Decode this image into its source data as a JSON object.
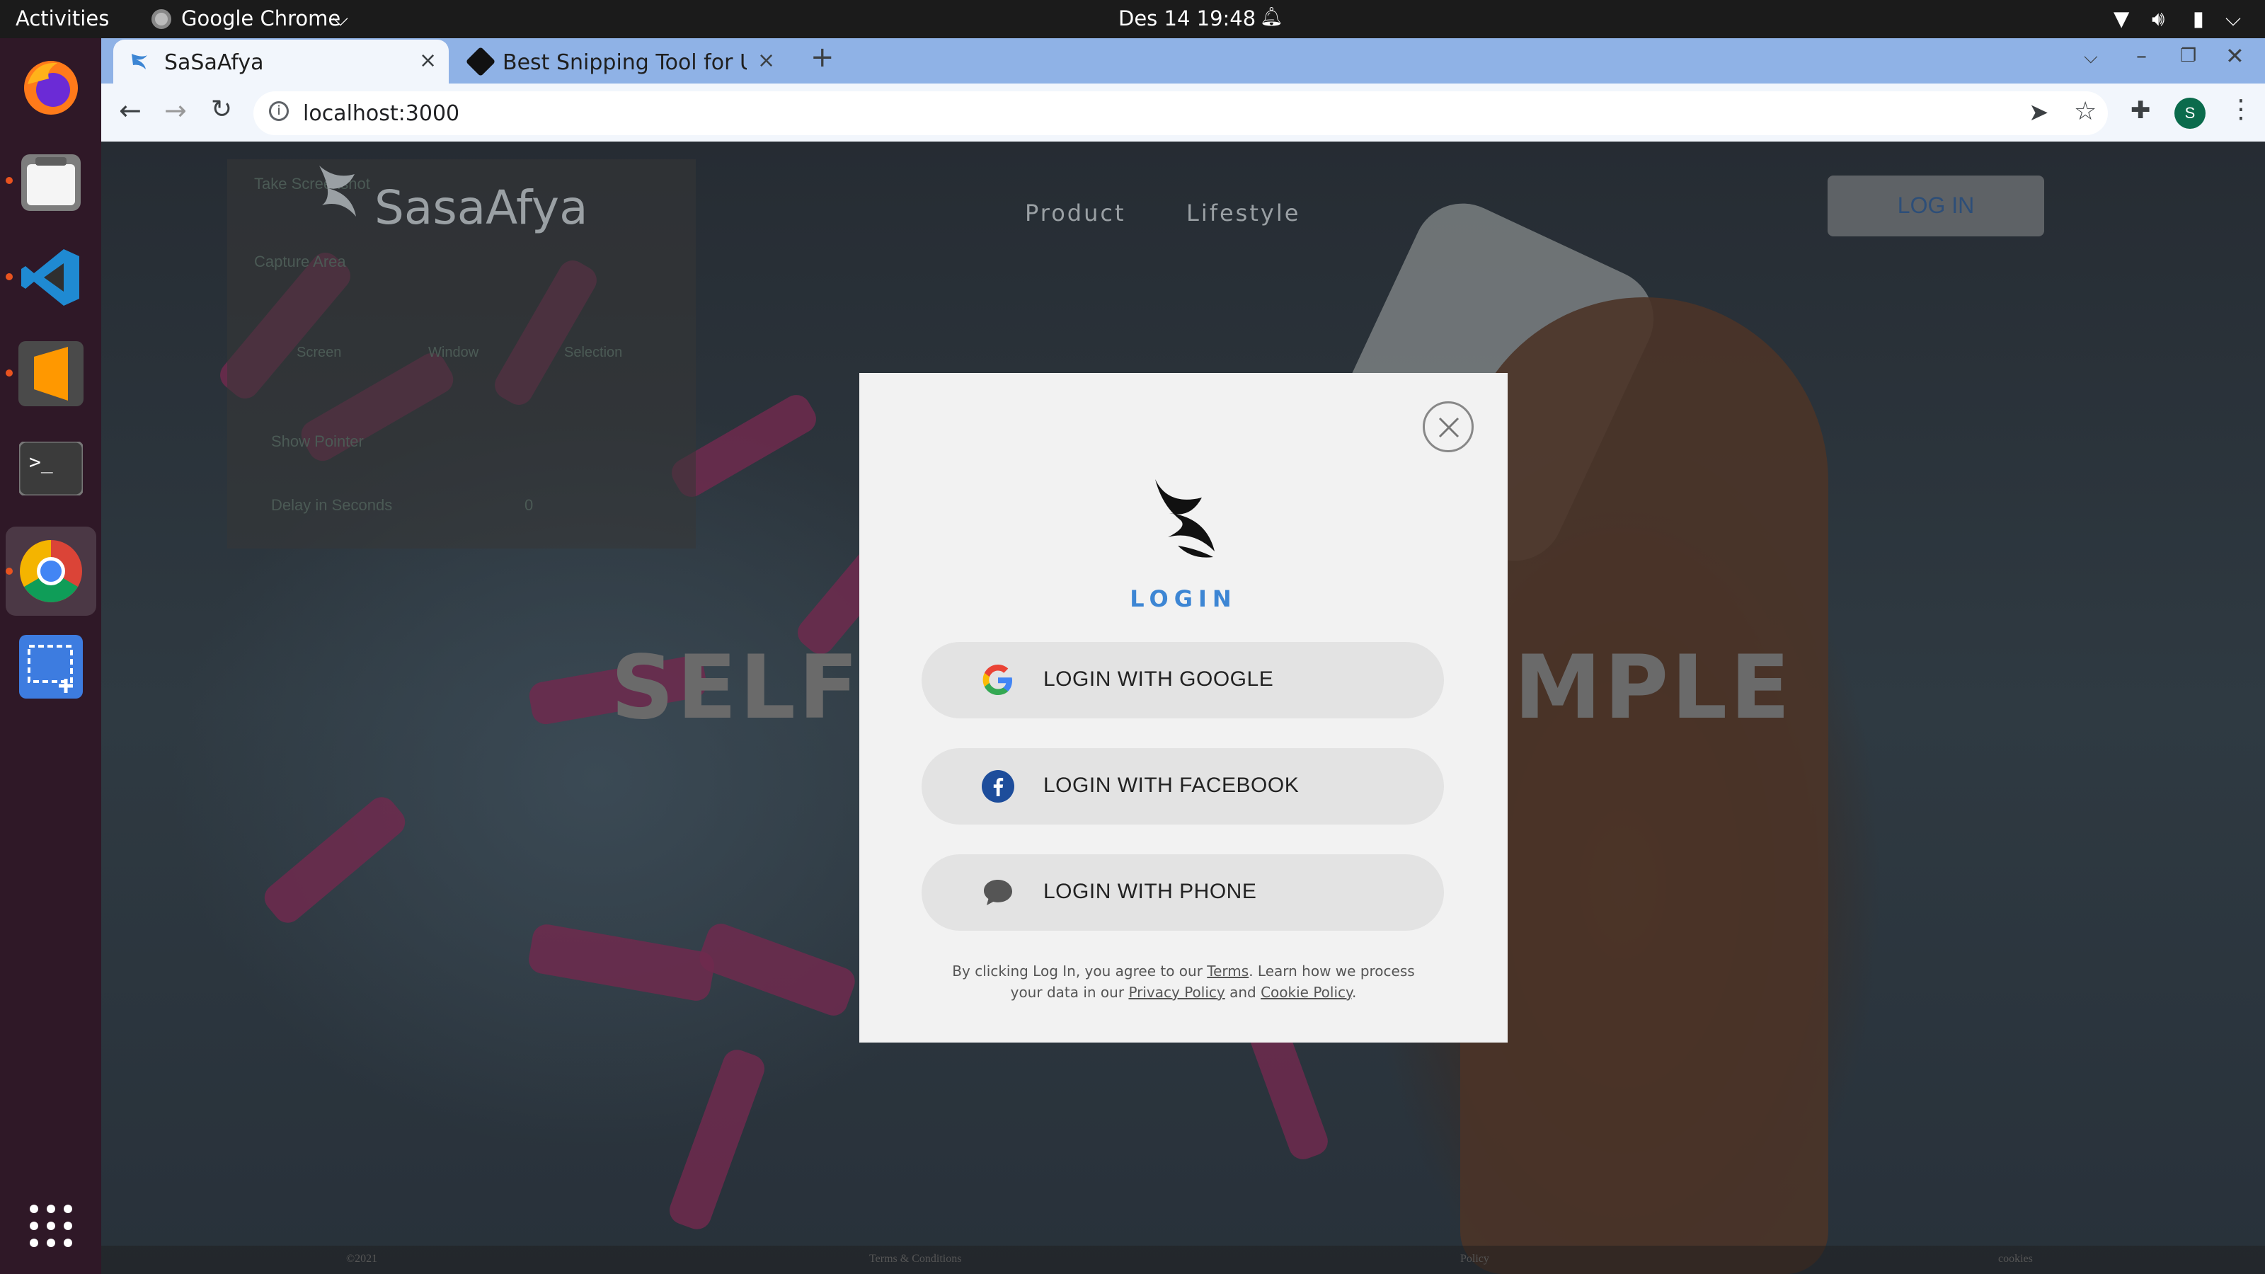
{
  "topbar": {
    "activities": "Activities",
    "app_name": "Google Chrome",
    "clock": "Des 14  19:48"
  },
  "browser": {
    "tabs": [
      {
        "title": "SaSaAfya"
      },
      {
        "title": "Best Snipping Tool for Ub"
      }
    ],
    "url": "localhost:3000",
    "profile_initial": "S"
  },
  "site": {
    "logo_text": "SasaAfya",
    "nav": [
      "Product",
      "Lifestyle"
    ],
    "login_button": "LOG IN",
    "hero_left": "SELFC",
    "hero_right": "MPLE",
    "footer": [
      "©2021",
      "Terms & Conditions",
      "Policy",
      "cookies"
    ],
    "snip_panel": {
      "title": "Take Screenshot",
      "section": "Capture Area",
      "options": [
        "Screen",
        "Window",
        "Selection"
      ],
      "show_pointer": "Show Pointer",
      "delay": "Delay in Seconds",
      "delay_value": "0"
    }
  },
  "modal": {
    "heading": "LOGIN",
    "buttons": {
      "google": "LOGIN WITH GOOGLE",
      "facebook": "LOGIN WITH FACEBOOK",
      "phone": "LOGIN WITH PHONE"
    },
    "legal": {
      "prefix": "By clicking Log In, you agree to our ",
      "terms": "Terms",
      "middle1": ". Learn how we process",
      "middle2": "your data in our ",
      "privacy": "Privacy Policy",
      "and": " and ",
      "cookie": "Cookie Policy",
      "end": "."
    }
  },
  "colors": {
    "accent_blue": "#3d86d4",
    "tabstrip": "#8fb2e6",
    "modal_bg": "#f2f2f2",
    "facebook_blue": "#1d4d9b"
  },
  "icons": [
    "firefox-icon",
    "files-icon",
    "vscode-icon",
    "sublime-icon",
    "terminal-icon",
    "chrome-icon",
    "screenshot-icon",
    "app-grid-icon"
  ]
}
